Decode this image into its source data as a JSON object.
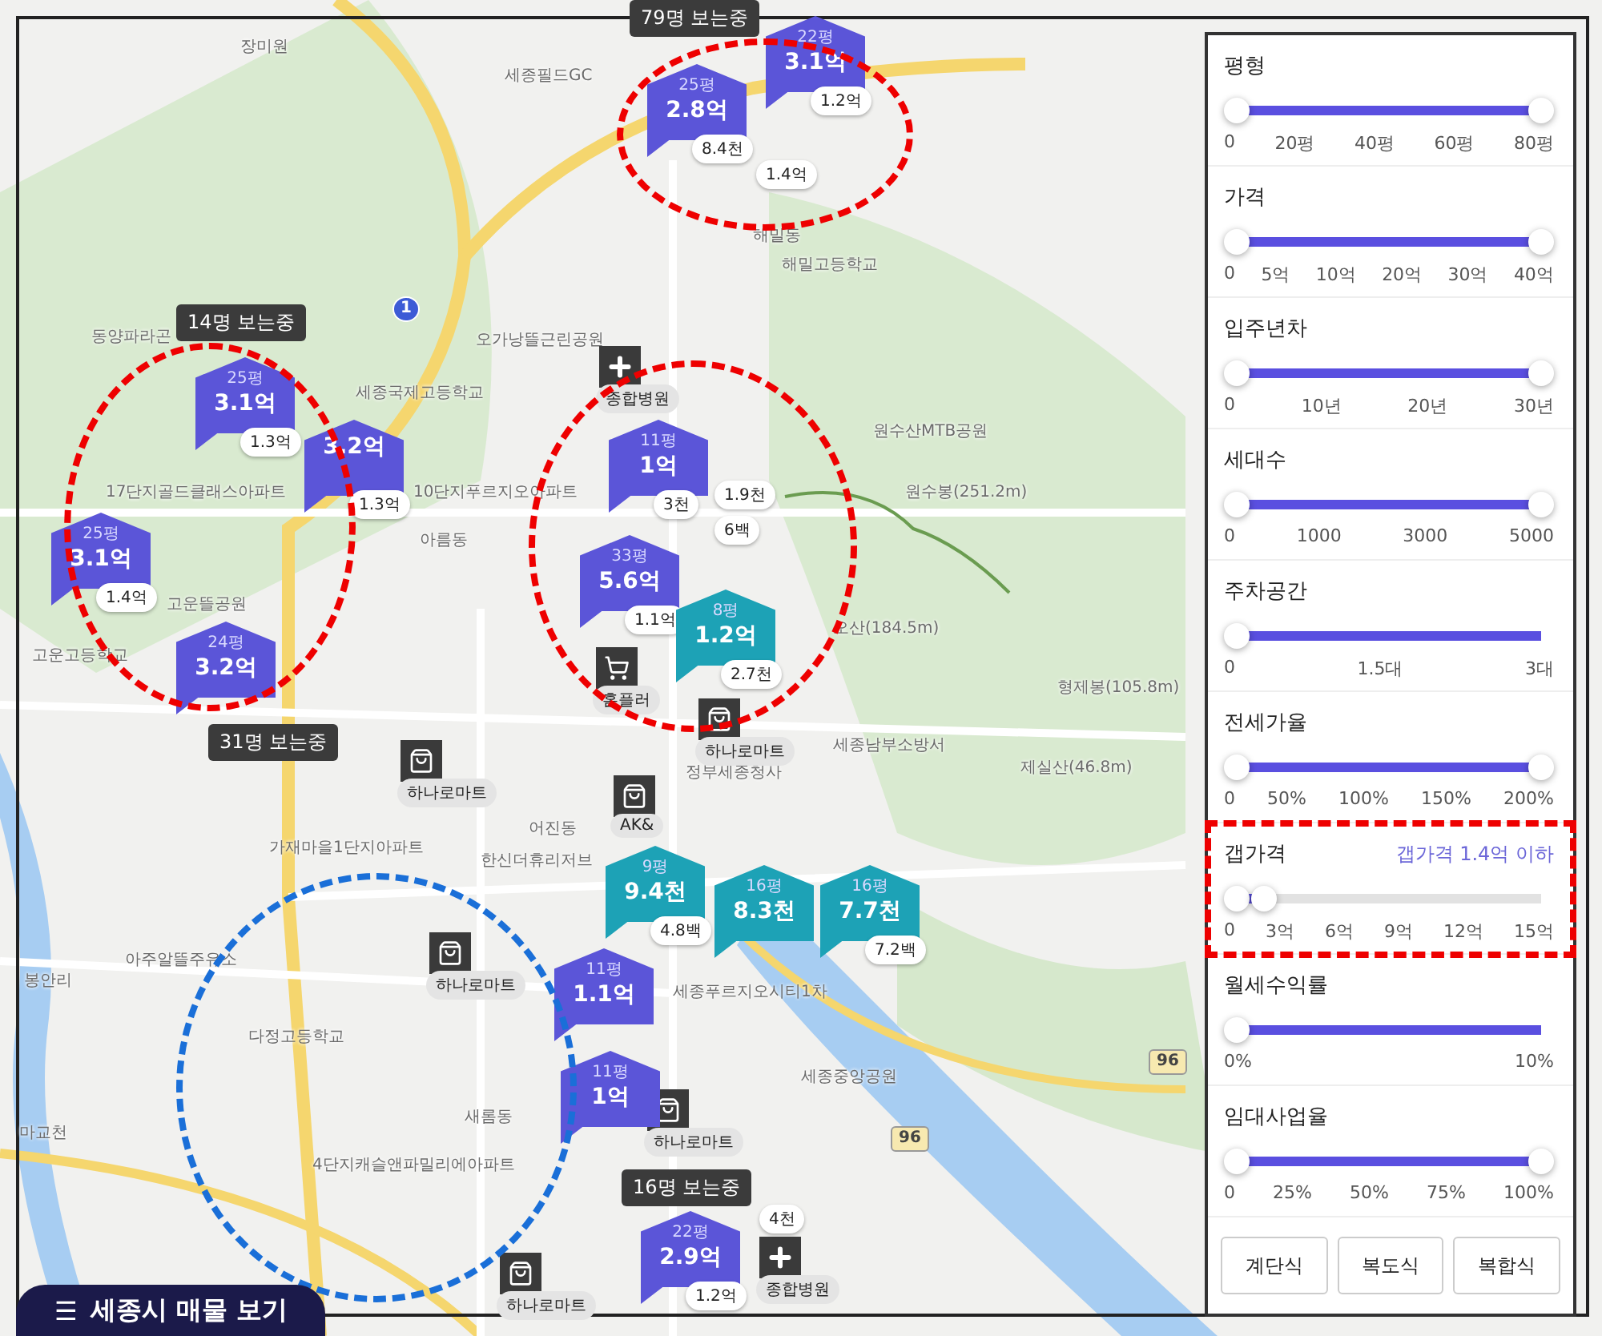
{
  "map": {
    "places": [
      "장미원",
      "세종필드GC",
      "해밀동",
      "해밀고등학교",
      "동양파라곤",
      "세종국제고등학교",
      "오가낭뜰근린공원",
      "10단지푸르지오아파트",
      "아름동",
      "17단지골드클래스아파트",
      "고운뜰공원",
      "고운고등학교",
      "원수산MTB공원",
      "원수봉(251.2m)",
      "오산(184.5m)",
      "형제봉(105.8m)",
      "세종남부소방서",
      "정부세종청사",
      "제실산(46.8m)",
      "어진동",
      "가재마을1단지아파트",
      "아주알뜰주유소",
      "봉안리",
      "다정고등학교",
      "새롬동",
      "4단지캐슬앤파밀리에아파트",
      "세종푸르지오시티1차",
      "세종중앙공원",
      "마교천",
      "한신더휴리저브"
    ],
    "road_signs": [
      "1",
      "96",
      "96"
    ],
    "pois": [
      {
        "kind": "hospital",
        "label": "종합병원"
      },
      {
        "kind": "cart",
        "label": "홈플러"
      },
      {
        "kind": "bag",
        "label": "하나로마트"
      },
      {
        "kind": "bag",
        "label": "하나로마트"
      },
      {
        "kind": "bag",
        "label": "AK&"
      },
      {
        "kind": "bag",
        "label": "하나로마트"
      },
      {
        "kind": "bag",
        "label": "하나로마트"
      },
      {
        "kind": "bag",
        "label": "하나로마트"
      },
      {
        "kind": "hospital",
        "label": "종합병원"
      }
    ],
    "markers": [
      {
        "size": "22평",
        "price": "3.1억",
        "badge": "1.2억",
        "color": "#5b55d8"
      },
      {
        "size": "25평",
        "price": "2.8억",
        "badge": "8.4천",
        "color": "#5b55d8"
      },
      {
        "size": "25평",
        "price": "3.1억",
        "badge": "1.3억",
        "color": "#5b55d8"
      },
      {
        "price": "3.2억",
        "badge": "1.3억",
        "color": "#5b55d8"
      },
      {
        "size": "25평",
        "price": "3.1억",
        "badge": "1.4억",
        "color": "#5b55d8"
      },
      {
        "size": "24평",
        "price": "3.2억",
        "color": "#5b55d8"
      },
      {
        "size": "11평",
        "price": "1억",
        "badge": "3천",
        "color": "#5b55d8"
      },
      {
        "size": "33평",
        "price": "5.6억",
        "badge": "1.1억",
        "color": "#5b55d8"
      },
      {
        "size": "8평",
        "price": "1.2억",
        "badge": "2.7천",
        "color": "#1da2b6"
      },
      {
        "size": "9평",
        "price": "9.4천",
        "badge": "4.8백",
        "color": "#1da2b6"
      },
      {
        "size": "16평",
        "price": "8.3천",
        "color": "#1da2b6"
      },
      {
        "size": "16평",
        "price": "7.7천",
        "badge": "7.2백",
        "color": "#1da2b6"
      },
      {
        "size": "11평",
        "price": "1.1억",
        "color": "#5b55d8"
      },
      {
        "size": "11평",
        "price": "1억",
        "color": "#5b55d8"
      },
      {
        "size": "22평",
        "price": "2.9억",
        "badge": "1.2억",
        "color": "#5b55d8"
      }
    ],
    "loose_badges": [
      "1.4억",
      "1.9천",
      "6백",
      "4천"
    ],
    "viewers": [
      "79명 보는중",
      "14명 보는중",
      "31명 보는중",
      "16명 보는중"
    ],
    "list_button": {
      "icon": "☰",
      "label": "세종시 매물 보기"
    }
  },
  "filters": [
    {
      "label": "평형",
      "kind": "range",
      "level": 1,
      "ticks": [
        "0",
        "20평",
        "40평",
        "60평",
        "80평"
      ]
    },
    {
      "label": "가격",
      "kind": "range",
      "level": 1,
      "ticks": [
        "0",
        "5억",
        "10억",
        "20억",
        "30억",
        "40억"
      ]
    },
    {
      "label": "입주년차",
      "kind": "range",
      "level": 1,
      "ticks": [
        "0",
        "10년",
        "20년",
        "30년"
      ]
    },
    {
      "label": "세대수",
      "kind": "range",
      "level": 1,
      "ticks": [
        "0",
        "1000",
        "3000",
        "5000"
      ]
    },
    {
      "label": "주차공간",
      "kind": "min",
      "level": 1,
      "ticks": [
        "0",
        "1.5대",
        "3대"
      ]
    },
    {
      "label": "전세가율",
      "kind": "range",
      "level": 1,
      "ticks": [
        "0",
        "50%",
        "100%",
        "150%",
        "200%"
      ]
    },
    {
      "label": "갭가격",
      "kind": "range",
      "level": 0.09,
      "note": "갭가격 1.4억 이하",
      "highlighted": true,
      "ticks": [
        "0",
        "3억",
        "6억",
        "9억",
        "12억",
        "15억"
      ]
    },
    {
      "label": "월세수익률",
      "kind": "min",
      "level": 1,
      "ticks": [
        "0%",
        "10%"
      ]
    },
    {
      "label": "임대사업율",
      "kind": "range",
      "level": 1,
      "ticks": [
        "0",
        "25%",
        "50%",
        "75%",
        "100%"
      ]
    }
  ],
  "type_buttons": [
    "계단식",
    "복도식",
    "복합식"
  ]
}
